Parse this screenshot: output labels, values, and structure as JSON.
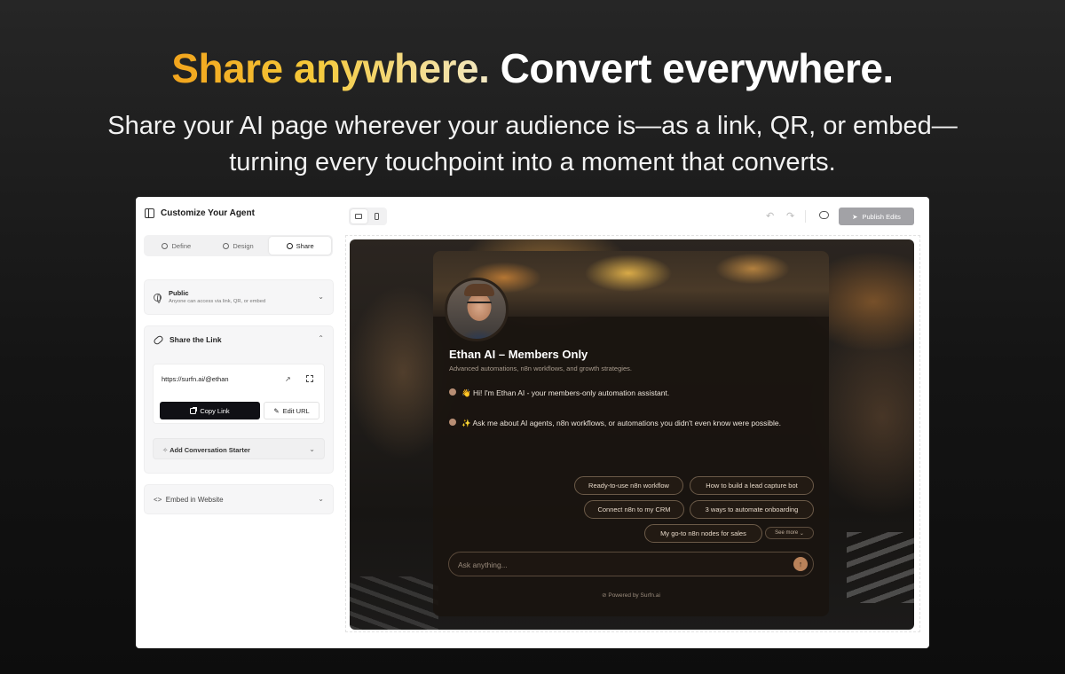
{
  "hero": {
    "headline_highlight": "Share anywhere.",
    "headline_rest": "Convert everywhere.",
    "subtitle_line1": "Share your AI page wherever your audience is—as a link, QR, or embed—",
    "subtitle_line2": "turning every touchpoint into a moment that converts."
  },
  "sidebar": {
    "title": "Customize Your Agent",
    "tabs": [
      {
        "label": "Define",
        "active": false
      },
      {
        "label": "Design",
        "active": false
      },
      {
        "label": "Share",
        "active": true
      }
    ],
    "visibility": {
      "title": "Public",
      "subtitle": "Anyone can access via link, QR, or embed"
    },
    "share_link": {
      "title": "Share the Link",
      "url": "https://surfn.ai/@ethan",
      "copy_label": "Copy Link",
      "edit_label": "Edit URL",
      "starter_label": "Add Conversation Starter"
    },
    "embed": {
      "title": "Embed in Website"
    }
  },
  "toolbar": {
    "publish_label": "Publish Edits"
  },
  "preview": {
    "title": "Ethan AI – Members Only",
    "subtitle": "Advanced automations, n8n workflows, and growth strategies.",
    "messages": [
      "👋 Hi! I'm Ethan AI - your members-only automation assistant.",
      "✨ Ask me about AI agents, n8n workflows, or automations you didn't even know were possible."
    ],
    "chips": [
      "Ready-to-use n8n workflow",
      "How to build a lead capture bot",
      "Connect n8n to my CRM",
      "3 ways to automate onboarding",
      "My go-to n8n nodes for sales"
    ],
    "see_more": "See more",
    "input_placeholder": "Ask anything...",
    "powered_by": "Powered by Surfn.ai"
  },
  "colors": {
    "accent_gold": "#f2a41c",
    "dark_button": "#101015",
    "publish_button": "#a2a2a6",
    "send_button": "#b9825a"
  }
}
